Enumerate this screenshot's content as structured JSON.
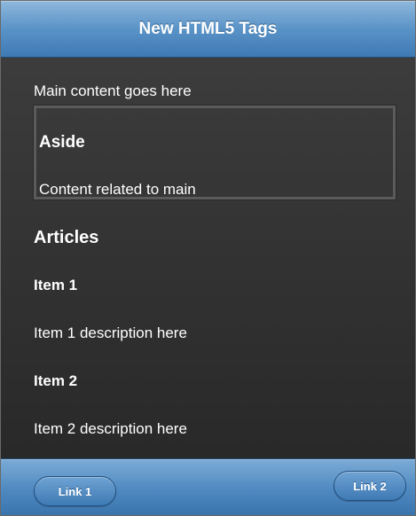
{
  "header": {
    "title": "New HTML5 Tags"
  },
  "main": {
    "text": "Main content goes here",
    "aside": {
      "title": "Aside",
      "text": "Content related to main"
    },
    "articles": {
      "title": "Articles",
      "items": [
        {
          "title": "Item 1",
          "description": "Item 1 description here"
        },
        {
          "title": "Item 2",
          "description": "Item 2 description here"
        }
      ]
    }
  },
  "footer": {
    "links": [
      {
        "label": "Link 1"
      },
      {
        "label": "Link 2"
      }
    ]
  },
  "colors": {
    "header_blue": "#5a93c7",
    "footer_blue": "#4f89c0",
    "content_background": "#333333",
    "text": "#ffffff"
  }
}
